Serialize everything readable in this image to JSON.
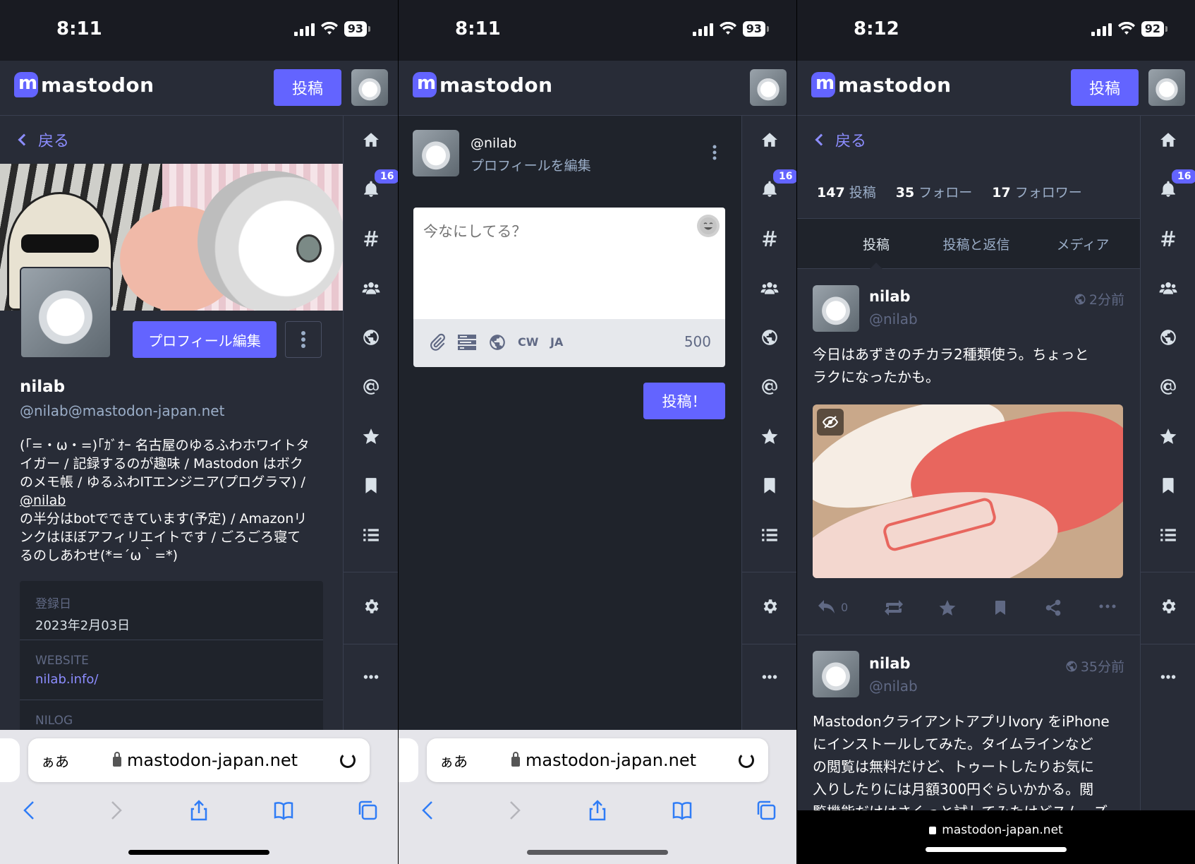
{
  "status_bars": [
    {
      "time": "8:11",
      "battery": "93"
    },
    {
      "time": "8:11",
      "battery": "93"
    },
    {
      "time": "8:12",
      "battery": "92"
    }
  ],
  "app": {
    "logo_text": "mastodon",
    "post_button": "投稿",
    "back_label": "戻る"
  },
  "rail": {
    "notification_badge": "16"
  },
  "profile": {
    "name": "nilab",
    "handle": "@nilab@mastodon-japan.net",
    "edit_button": "プロフィール編集",
    "bio_line1": "(｢=・ω・=)｢ｶﾞｵｰ 名古屋のゆるふわホワイトタ",
    "bio_line2": "イガー / 記録するのが趣味 / Mastodon はボク",
    "bio_line3": "のメモ帳 / ゆるふわITエンジニア(プログラマ) /",
    "bio_mention": "@nilab",
    "bio_line4": "の半分はbotでできています(予定) / Amazonリ",
    "bio_line5": "ンクはほぼアフィリエイトです / ごろごろ寝て",
    "bio_line6": "るのしあわせ(*=´ω｀=*)",
    "fields": [
      {
        "label": "登録日",
        "value": "2023年2月03日"
      },
      {
        "label": "WEBSITE",
        "value": "nilab.info/"
      },
      {
        "label": "NILOG",
        "value": ""
      }
    ]
  },
  "compose": {
    "handle": "@nilab",
    "edit_profile_link": "プロフィールを編集",
    "placeholder": "今なにしてる？",
    "cw_label": "CW",
    "lang_label": "JA",
    "char_count": "500",
    "submit_button": "投稿！"
  },
  "account": {
    "stats": [
      {
        "count": "147",
        "label": "投稿"
      },
      {
        "count": "35",
        "label": "フォロー"
      },
      {
        "count": "17",
        "label": "フォロワー"
      }
    ],
    "tabs": [
      "投稿",
      "投稿と返信",
      "メディア"
    ],
    "posts": [
      {
        "name": "nilab",
        "handle": "@nilab",
        "time": "2分前",
        "text_line1": "今日はあずきのチカラ2種類使う。ちょっと",
        "text_line2": "ラクになったかも。",
        "reply_count": "0"
      },
      {
        "name": "nilab",
        "handle": "@nilab",
        "time": "35分前",
        "text_line1": "MastodonクライアントアプリIvory をiPhone",
        "text_line2": "にインストールしてみた。タイムラインなど",
        "text_line3": "の閲覧は無料だけど、トゥートしたりお気に",
        "text_line4": "入りしたりには月額300円ぐらいかかる。閲",
        "text_line5": "覧機能だけはさくっと試してみたけどスムーズ"
      }
    ]
  },
  "browser": {
    "text_size_label": "ぁあ",
    "domain": "mastodon-japan.net"
  },
  "colors": {
    "accent": "#6364ff",
    "link": "#8c8dff",
    "bg": "#282c37",
    "dark": "#191b22",
    "compose_bg": "#1f232b"
  }
}
